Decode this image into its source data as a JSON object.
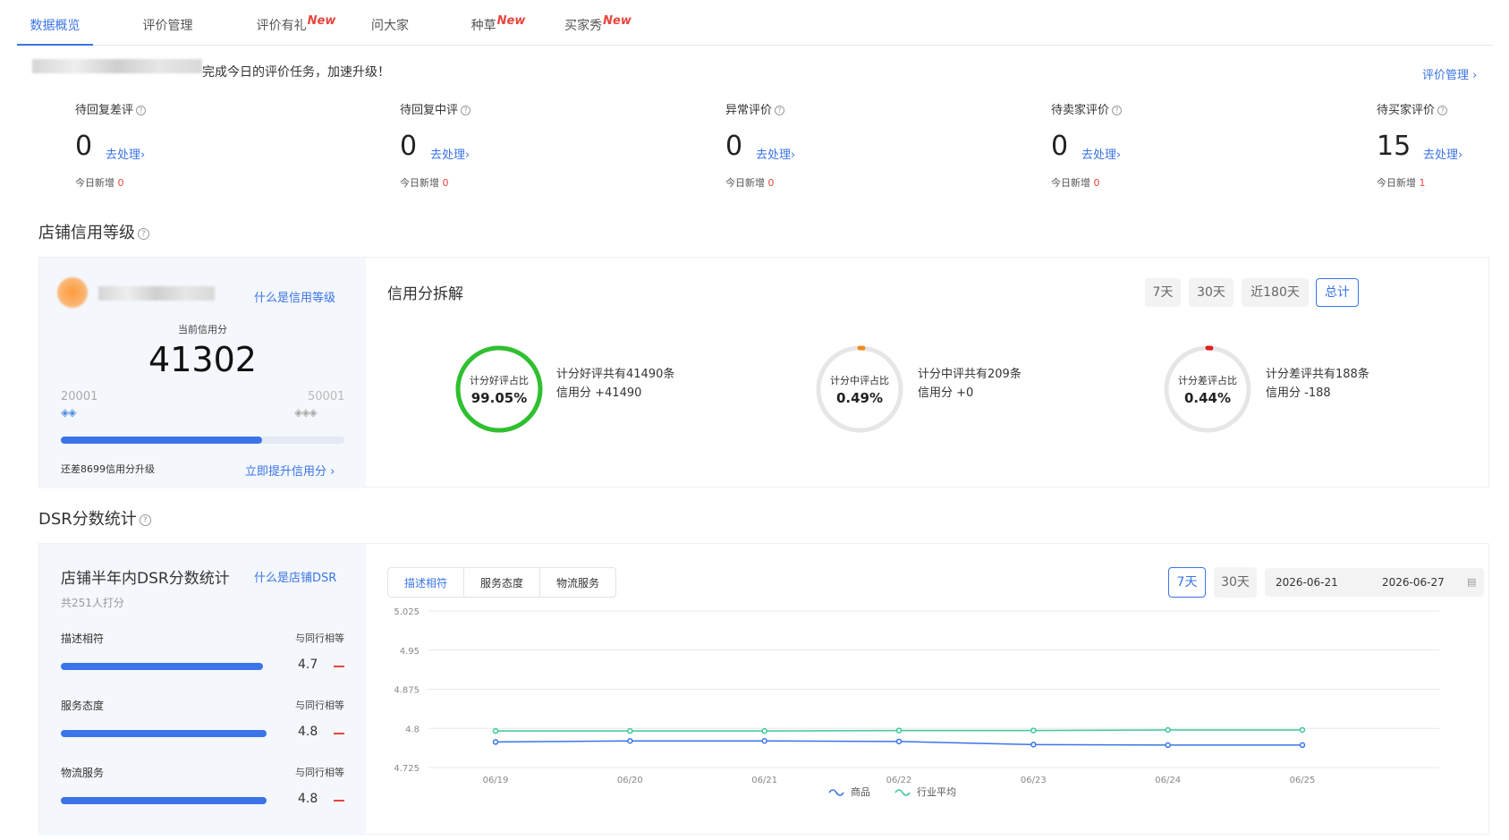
{
  "tabs": [
    {
      "label": "数据概览",
      "new": ""
    },
    {
      "label": "评价管理",
      "new": ""
    },
    {
      "label": "评价有礼",
      "new": "New"
    },
    {
      "label": "问大家",
      "new": ""
    },
    {
      "label": "种草",
      "new": "New"
    },
    {
      "label": "买家秀",
      "new": "New"
    }
  ],
  "greeting": "完成今日的评价任务，加速升级！",
  "manage_link": "评价管理 ›",
  "stats": [
    {
      "label": "待回复差评",
      "value": "0",
      "action": "去处理›",
      "today_label": "今日新增",
      "today": "0"
    },
    {
      "label": "待回复中评",
      "value": "0",
      "action": "去处理›",
      "today_label": "今日新增",
      "today": "0"
    },
    {
      "label": "异常评价",
      "value": "0",
      "action": "去处理›",
      "today_label": "今日新增",
      "today": "0"
    },
    {
      "label": "待卖家评价",
      "value": "0",
      "action": "去处理›",
      "today_label": "今日新增",
      "today": "0"
    },
    {
      "label": "待买家评价",
      "value": "15",
      "action": "去处理›",
      "today_label": "今日新增",
      "today": "1"
    }
  ],
  "credit": {
    "section_title": "店铺信用等级",
    "what_link": "什么是信用等级",
    "current_label": "当前信用分",
    "score": "41302",
    "min": "20001",
    "max": "50001",
    "progress": 0.71,
    "gap_text": "还差8699信用分升级",
    "boost_link": "立即提升信用分 ›",
    "breakdown_title": "信用分拆解",
    "ranges": [
      "7天",
      "30天",
      "近180天",
      "总计"
    ],
    "active_range": "总计",
    "items": [
      {
        "ring_label": "计分好评占比",
        "pct": "99.05%",
        "ratio": 0.9905,
        "count_text": "计分好评共有41490条",
        "score_text": "信用分 +41490",
        "color": "#2fc02f"
      },
      {
        "ring_label": "计分中评占比",
        "pct": "0.49%",
        "ratio": 0.0049,
        "count_text": "计分中评共有209条",
        "score_text": "信用分 +0",
        "color": "#f08a1c"
      },
      {
        "ring_label": "计分差评占比",
        "pct": "0.44%",
        "ratio": 0.0044,
        "count_text": "计分差评共有188条",
        "score_text": "信用分 -188",
        "color": "#e01e1e"
      }
    ]
  },
  "dsr": {
    "section_title": "DSR分数统计",
    "card_title": "店铺半年内DSR分数统计",
    "what_link": "什么是店铺DSR",
    "raters": "共251人打分",
    "metrics": [
      {
        "label": "描述相符",
        "compare": "与同行相等",
        "value": "4.7",
        "ratio": 0.94
      },
      {
        "label": "服务态度",
        "compare": "与同行相等",
        "value": "4.8",
        "ratio": 0.96
      },
      {
        "label": "物流服务",
        "compare": "与同行相等",
        "value": "4.8",
        "ratio": 0.96
      }
    ],
    "chart_tabs": [
      "描述相符",
      "服务态度",
      "物流服务"
    ],
    "active_chart_tab": "描述相符",
    "ranges": [
      "7天",
      "30天"
    ],
    "active_range": "7天",
    "date_start": "2026-06-21",
    "date_end": "2026-06-27"
  },
  "chart_data": {
    "type": "line",
    "x": [
      "06/19",
      "06/20",
      "06/21",
      "06/22",
      "06/23",
      "06/24",
      "06/25"
    ],
    "ylim": [
      4.725,
      5.025
    ],
    "yticks": [
      "5.025",
      "4.95",
      "4.875",
      "4.8",
      "4.725"
    ],
    "series": [
      {
        "name": "商品",
        "color": "#3b74e8",
        "values": [
          4.774,
          4.776,
          4.776,
          4.775,
          4.769,
          4.768,
          4.768
        ]
      },
      {
        "name": "行业平均",
        "color": "#3cc89a",
        "values": [
          4.795,
          4.795,
          4.795,
          4.796,
          4.796,
          4.797,
          4.797
        ]
      }
    ]
  }
}
